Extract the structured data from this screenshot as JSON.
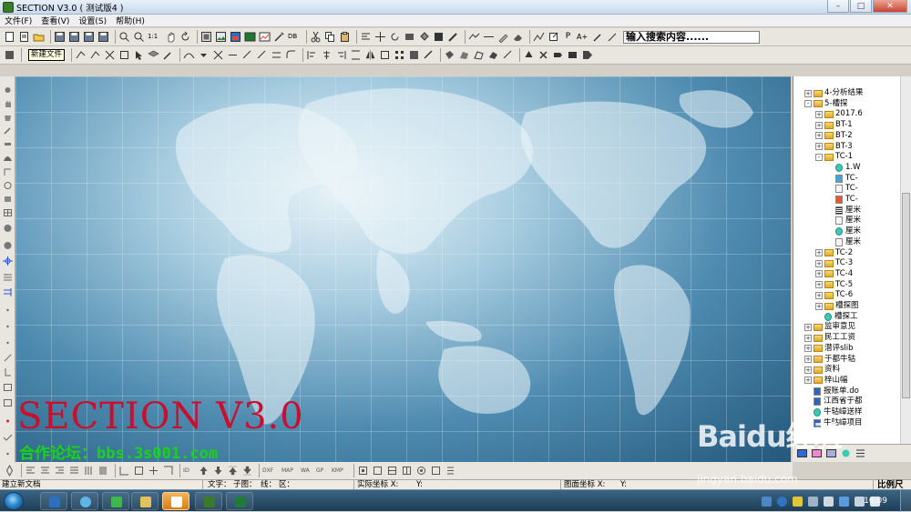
{
  "window": {
    "title": "SECTION V3.0 ( 测试版4 )"
  },
  "menu": [
    "文件(F)",
    "查看(V)",
    "设置(S)",
    "帮助(H)"
  ],
  "toolbar": {
    "search_value": "输入搜索内容......",
    "tooltip": "新建文件"
  },
  "splash": {
    "title": "SECTION  V3.0",
    "forum": "合作论坛：bbs.3s001.com"
  },
  "tree": [
    {
      "indent": 3,
      "exp": "+",
      "kind": "folder",
      "label": "4-分析结果"
    },
    {
      "indent": 3,
      "exp": "-",
      "kind": "folder",
      "label": "5-槽探"
    },
    {
      "indent": 4,
      "exp": "+",
      "kind": "folder",
      "label": "2017.6"
    },
    {
      "indent": 4,
      "exp": "+",
      "kind": "folder",
      "label": "BT-1"
    },
    {
      "indent": 4,
      "exp": "+",
      "kind": "folder",
      "label": "BT-2"
    },
    {
      "indent": 4,
      "exp": "+",
      "kind": "folder",
      "label": "BT-3"
    },
    {
      "indent": 4,
      "exp": "-",
      "kind": "folder",
      "label": "TC-1"
    },
    {
      "indent": 5,
      "exp": "",
      "kind": "teal",
      "label": "1.W"
    },
    {
      "indent": 5,
      "exp": "",
      "kind": "pic",
      "label": "TC-"
    },
    {
      "indent": 5,
      "exp": "",
      "kind": "file",
      "label": "TC-"
    },
    {
      "indent": 5,
      "exp": "",
      "kind": "red",
      "label": "TC-"
    },
    {
      "indent": 5,
      "exp": "",
      "kind": "lines",
      "label": "厘米"
    },
    {
      "indent": 5,
      "exp": "",
      "kind": "file",
      "label": "厘米"
    },
    {
      "indent": 5,
      "exp": "",
      "kind": "teal",
      "label": "厘米"
    },
    {
      "indent": 5,
      "exp": "",
      "kind": "file",
      "label": "厘米"
    },
    {
      "indent": 4,
      "exp": "+",
      "kind": "folder",
      "label": "TC-2"
    },
    {
      "indent": 4,
      "exp": "+",
      "kind": "folder",
      "label": "TC-3"
    },
    {
      "indent": 4,
      "exp": "+",
      "kind": "folder",
      "label": "TC-4"
    },
    {
      "indent": 4,
      "exp": "+",
      "kind": "folder",
      "label": "TC-5"
    },
    {
      "indent": 4,
      "exp": "+",
      "kind": "folder",
      "label": "TC-6"
    },
    {
      "indent": 4,
      "exp": "+",
      "kind": "folder",
      "label": "槽探图"
    },
    {
      "indent": 4,
      "exp": "",
      "kind": "teal",
      "label": "槽探工"
    },
    {
      "indent": 3,
      "exp": "+",
      "kind": "folder",
      "label": "监审意见"
    },
    {
      "indent": 3,
      "exp": "+",
      "kind": "folder",
      "label": "民工工资"
    },
    {
      "indent": 3,
      "exp": "+",
      "kind": "folder",
      "label": "潜评slib"
    },
    {
      "indent": 3,
      "exp": "+",
      "kind": "folder",
      "label": "于都牛轱"
    },
    {
      "indent": 3,
      "exp": "+",
      "kind": "folder",
      "label": "资料"
    },
    {
      "indent": 3,
      "exp": "+",
      "kind": "folder",
      "label": "梓山幅"
    },
    {
      "indent": 3,
      "exp": "",
      "kind": "doc",
      "label": "报账单.do"
    },
    {
      "indent": 3,
      "exp": "",
      "kind": "doc",
      "label": "江西省于都"
    },
    {
      "indent": 3,
      "exp": "",
      "kind": "teal",
      "label": "牛轱嶂送样"
    },
    {
      "indent": 3,
      "exp": "",
      "kind": "doc",
      "label": "牛轱嶂项目"
    }
  ],
  "status": {
    "new_doc": "建立新文档",
    "text_label": "文字：",
    "subfig_label": "子图：",
    "line_label": "线：",
    "area_label": "区：",
    "real_coords_label": "实际坐标 X:",
    "real_y_label": "Y:",
    "fig_coords_label": "图面坐标 X:",
    "fig_y_label": "Y:",
    "scale_label": "比例尺"
  },
  "taskbar": {
    "time": "16:09"
  },
  "watermark": {
    "brand": "Baidu经验",
    "url": "jingyan.baidu.com"
  }
}
